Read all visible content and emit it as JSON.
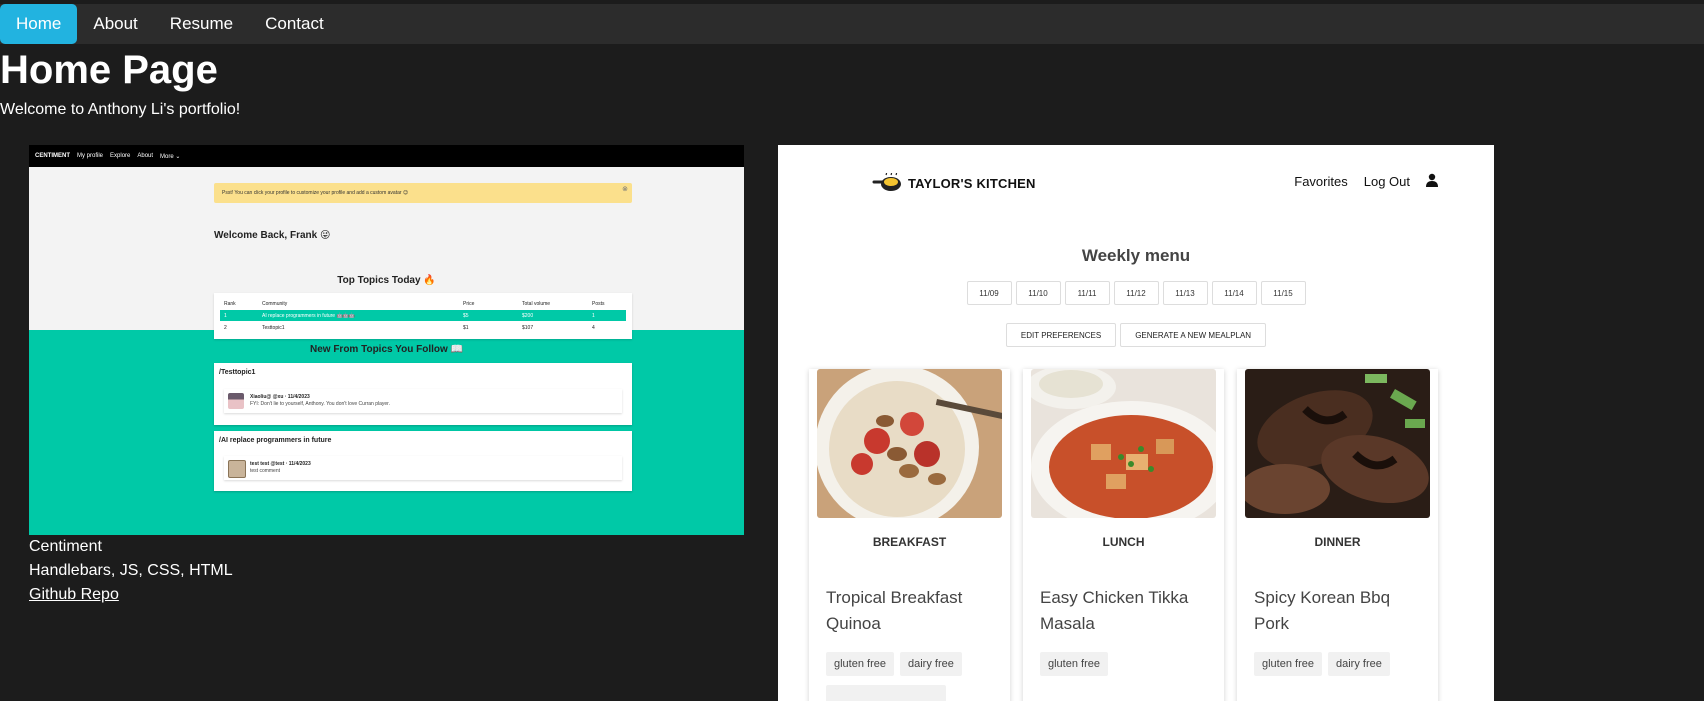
{
  "nav": {
    "items": [
      {
        "label": "Home",
        "active": true
      },
      {
        "label": "About",
        "active": false
      },
      {
        "label": "Resume",
        "active": false
      },
      {
        "label": "Contact",
        "active": false
      }
    ],
    "active_color": "#22b3e0"
  },
  "page": {
    "title": "Home Page",
    "welcome": "Welcome to Anthony Li's portfolio!"
  },
  "projects": [
    {
      "name": "Centiment",
      "tech": "Handlebars, JS, CSS, HTML",
      "link_label": "Github Repo",
      "screenshot": {
        "nav": [
          "CENTIMENT",
          "My profile",
          "Explore",
          "About",
          "More ⌄"
        ],
        "alert": "Psst! You can click your profile to customize your profile and add a custom avatar 😉",
        "alert_close": "⊗",
        "welcome": "Welcome Back, Frank 😜",
        "top_topics_title": "Top Topics Today 🔥",
        "table": {
          "headers": [
            "Rank",
            "Community",
            "Price",
            "Total volume",
            "Posts"
          ],
          "rows": [
            [
              "1",
              "AI replace programmers in future 🤖🤖🤖",
              "$5",
              "$200",
              "1"
            ],
            [
              "2",
              "Testtopic1",
              "$1",
              "$107",
              "4"
            ]
          ]
        },
        "follow_title": "New From Topics You Follow 📖",
        "feed": [
          {
            "topic": "/Testtopic1",
            "user": "Xiaoliu@ @xu · 11/4/2023",
            "text": "FYI: Don't lie to yourself, Anthony. You don't love Curran player."
          },
          {
            "topic": "/AI replace programmers in future",
            "user": "test test @test · 11/4/2023",
            "text": "test comment"
          }
        ],
        "accent": "#00c9a7"
      }
    },
    {
      "name": "Taylor's Kitchen",
      "screenshot": {
        "brand": "TAYLOR'S KITCHEN",
        "nav": [
          "Favorites",
          "Log Out"
        ],
        "weekly_title": "Weekly menu",
        "days": [
          "11/09",
          "11/10",
          "11/11",
          "11/12",
          "11/13",
          "11/14",
          "11/15"
        ],
        "actions": [
          "EDIT PREFERENCES",
          "GENERATE A NEW MEALPLAN"
        ],
        "meals": [
          {
            "type": "BREAKFAST",
            "name": "Tropical Breakfast Quinoa",
            "tags": [
              "gluten free",
              "dairy free"
            ]
          },
          {
            "type": "LUNCH",
            "name": "Easy Chicken Tikka Masala",
            "tags": [
              "gluten free"
            ]
          },
          {
            "type": "DINNER",
            "name": "Spicy Korean Bbq Pork",
            "tags": [
              "gluten free",
              "dairy free"
            ]
          }
        ]
      }
    }
  ]
}
